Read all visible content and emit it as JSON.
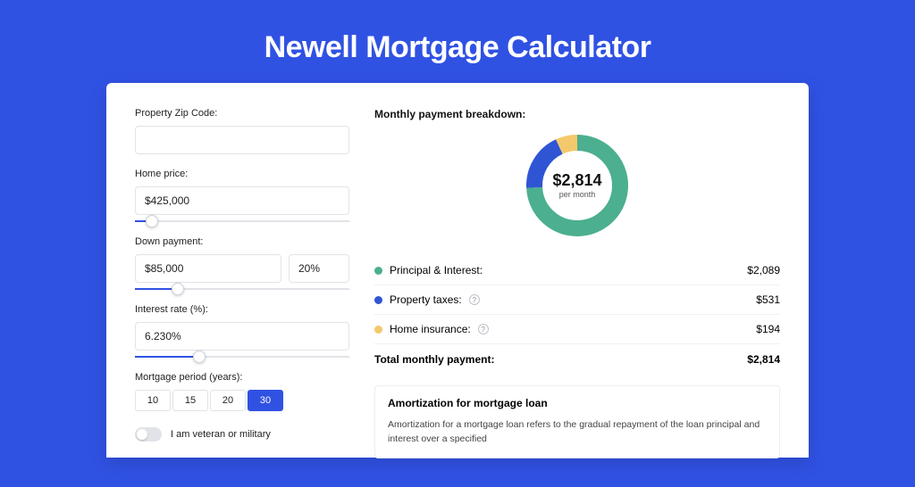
{
  "title": "Newell Mortgage Calculator",
  "colors": {
    "accent": "#3052E3",
    "green": "#4CAF8F",
    "blue": "#2F55D4",
    "yellow": "#F3C96B"
  },
  "form": {
    "zip": {
      "label": "Property Zip Code:",
      "value": ""
    },
    "home_price": {
      "label": "Home price:",
      "value": "$425,000",
      "slider_pct": 8
    },
    "down": {
      "label": "Down payment:",
      "value": "$85,000",
      "pct": "20%",
      "slider_pct": 20
    },
    "rate": {
      "label": "Interest rate (%):",
      "value": "6.230%",
      "slider_pct": 30
    },
    "period": {
      "label": "Mortgage period (years):",
      "options": [
        "10",
        "15",
        "20",
        "30"
      ],
      "selected": "30"
    },
    "veteran": {
      "label": "I am veteran or military",
      "on": false
    }
  },
  "breakdown": {
    "heading": "Monthly payment breakdown:",
    "center_value": "$2,814",
    "center_sub": "per month",
    "items": [
      {
        "label": "Principal & Interest:",
        "value": "$2,089",
        "colorKey": "green",
        "tooltip": false
      },
      {
        "label": "Property taxes:",
        "value": "$531",
        "colorKey": "blue",
        "tooltip": true
      },
      {
        "label": "Home insurance:",
        "value": "$194",
        "colorKey": "yellow",
        "tooltip": true
      }
    ],
    "total_label": "Total monthly payment:",
    "total_value": "$2,814"
  },
  "amortization": {
    "heading": "Amortization for mortgage loan",
    "body": "Amortization for a mortgage loan refers to the gradual repayment of the loan principal and interest over a specified"
  },
  "chart_data": {
    "type": "pie",
    "title": "Monthly payment breakdown",
    "unit": "$ per month",
    "series": [
      {
        "name": "Principal & Interest",
        "value": 2089,
        "color": "#4CAF8F"
      },
      {
        "name": "Property taxes",
        "value": 531,
        "color": "#2F55D4"
      },
      {
        "name": "Home insurance",
        "value": 194,
        "color": "#F3C96B"
      }
    ],
    "total": 2814
  }
}
